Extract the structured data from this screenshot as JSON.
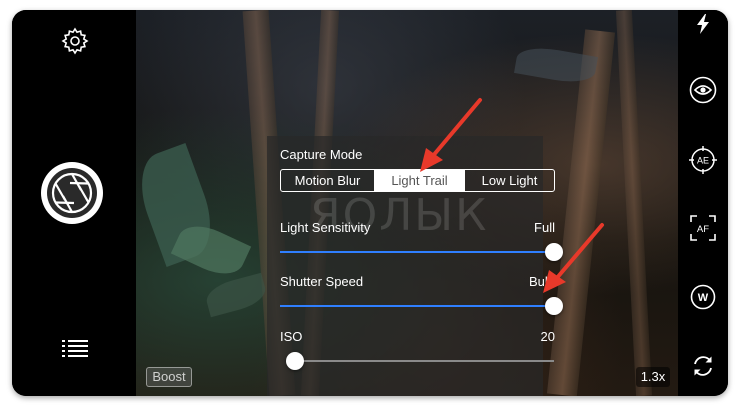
{
  "colors": {
    "accent": "#2f7fff",
    "annotation_arrow": "#e8392a",
    "panel_bg": "rgba(40,40,40,0.72)"
  },
  "left_bar": {
    "settings_icon": "gear-icon",
    "shutter_icon": "aperture-icon",
    "menu_icon": "list-icon"
  },
  "right_bar": {
    "icons": [
      "flash-icon",
      "eye-icon",
      "ae-icon",
      "af-icon",
      "white-balance-icon",
      "flip-camera-icon"
    ],
    "ae_label": "AE",
    "af_label": "AF",
    "wb_label": "W"
  },
  "viewfinder": {
    "boost_label": "Boost",
    "zoom_label": "1.3x",
    "watermark": "ЯОЛЫК"
  },
  "panel": {
    "capture_mode": {
      "label": "Capture Mode",
      "options": [
        "Motion Blur",
        "Light Trail",
        "Low Light"
      ],
      "selected": "Light Trail"
    },
    "light_sensitivity": {
      "label": "Light Sensitivity",
      "value": "Full",
      "level": 1.0
    },
    "shutter_speed": {
      "label": "Shutter Speed",
      "value": "Bulb",
      "level": 1.0
    },
    "iso": {
      "label": "ISO",
      "value": "20",
      "level": 0.0
    }
  }
}
